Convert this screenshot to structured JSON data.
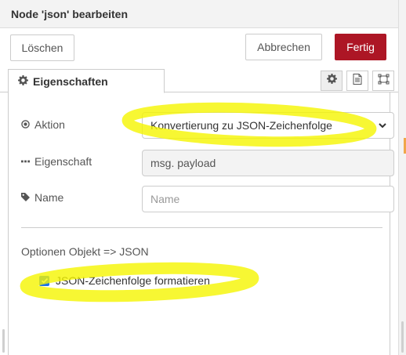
{
  "dialog": {
    "title": "Node 'json' bearbeiten"
  },
  "toolbar": {
    "delete_label": "Löschen",
    "cancel_label": "Abbrechen",
    "done_label": "Fertig"
  },
  "tabs": {
    "properties_label": "Eigenschaften"
  },
  "form": {
    "action": {
      "label": "Aktion",
      "value": "Konvertierung zu JSON-Zeichenfolge"
    },
    "property": {
      "label": "Eigenschaft",
      "value": "msg. payload"
    },
    "name": {
      "label": "Name",
      "value": "",
      "placeholder": "Name"
    }
  },
  "options": {
    "title": "Optionen Objekt => JSON",
    "pretty_label": "JSON-Zeichenfolge formatieren",
    "pretty_checked": true
  },
  "icons": {
    "tab": "gear-icon",
    "side": [
      "gear-icon",
      "document-icon",
      "frame-icon"
    ],
    "action": "radio-dot-icon",
    "property": "ellipsis-icon",
    "name": "tag-icon",
    "select": "chevron-down-icon"
  },
  "colors": {
    "primary_button": "#ad1625",
    "checkbox": "#1a73e8",
    "highlight": "#f5f500"
  }
}
